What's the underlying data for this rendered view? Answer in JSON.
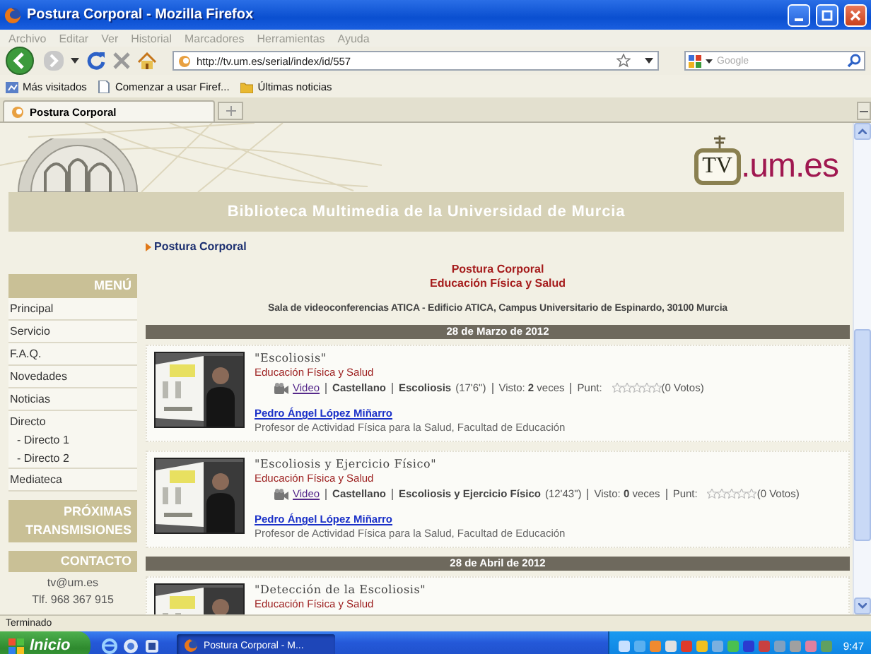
{
  "window": {
    "title": "Postura Corporal - Mozilla Firefox"
  },
  "menu_bar": [
    "Archivo",
    "Editar",
    "Ver",
    "Historial",
    "Marcadores",
    "Herramientas",
    "Ayuda"
  ],
  "address_bar": {
    "url": "http://tv.um.es/serial/index/id/557"
  },
  "search": {
    "placeholder": "Google"
  },
  "bookmarks": [
    "Más visitados",
    "Comenzar a usar Firef...",
    "Últimas noticias"
  ],
  "tabs": [
    {
      "label": "Postura Corporal",
      "selected": true
    }
  ],
  "site": {
    "logo_tv": "TV",
    "logo_domain": ".um.es",
    "banner_title": "Biblioteca Multimedia de la Universidad de Murcia"
  },
  "sidebar": {
    "menu_heading": "MENÚ",
    "items": [
      {
        "label": "Principal"
      },
      {
        "label": "Servicio"
      },
      {
        "label": "F.A.Q."
      },
      {
        "label": "Novedades"
      },
      {
        "label": "Noticias"
      },
      {
        "label": "Directo",
        "children": [
          {
            "label": "- Directo 1"
          },
          {
            "label": "- Directo 2"
          }
        ]
      },
      {
        "label": "Mediateca"
      }
    ],
    "upcoming_heading": "PRÓXIMAS TRANSMISIONES",
    "contact_heading": "CONTACTO",
    "contact_lines": [
      "tv@um.es",
      "Tlf. 968 367 915"
    ]
  },
  "breadcrumb": "Postura Corporal",
  "serial": {
    "title": "Postura Corporal",
    "subtitle": "Educación Física y Salud",
    "location": "Sala de videoconferencias ATICA - Edificio ATICA, Campus Universitario de Espinardo, 30100 Murcia"
  },
  "groups": [
    {
      "date": "28 de Marzo de 2012",
      "videos": [
        {
          "title": "\"Escoliosis\"",
          "category": "Educación Física y Salud",
          "format": "Video",
          "language": "Castellano",
          "topic": "Escoliosis",
          "duration": "(17'6\")",
          "views": "Visto: **2** veces",
          "rating_label": "Punt:",
          "stars": 0,
          "votes": "(0 Votos)",
          "author": "Pedro Ángel López Miñarro",
          "author_role": "Profesor de Actividad Física para la Salud, Facultad de Educación"
        },
        {
          "title": "\"Escoliosis y Ejercicio Físico\"",
          "category": "Educación Física y Salud",
          "format": "Video",
          "language": "Castellano",
          "topic": "Escoliosis y Ejercicio Físico",
          "duration": "(12'43\")",
          "views": "Visto: **0** veces",
          "rating_label": "Punt:",
          "stars": 0,
          "votes": "(0 Votos)",
          "author": "Pedro Ángel López Miñarro",
          "author_role": "Profesor de Actividad Física para la Salud, Facultad de Educación"
        }
      ]
    },
    {
      "date": "28 de Abril de 2012",
      "videos": [
        {
          "title": "\"Detección de la Escoliosis\"",
          "category": "Educación Física y Salud"
        }
      ]
    }
  ],
  "status_bar": "Terminado",
  "taskbar": {
    "start": "Inicio",
    "tasks": [
      {
        "label": "Postura Corporal - M...",
        "selected": true
      }
    ],
    "clock": "9:47"
  }
}
